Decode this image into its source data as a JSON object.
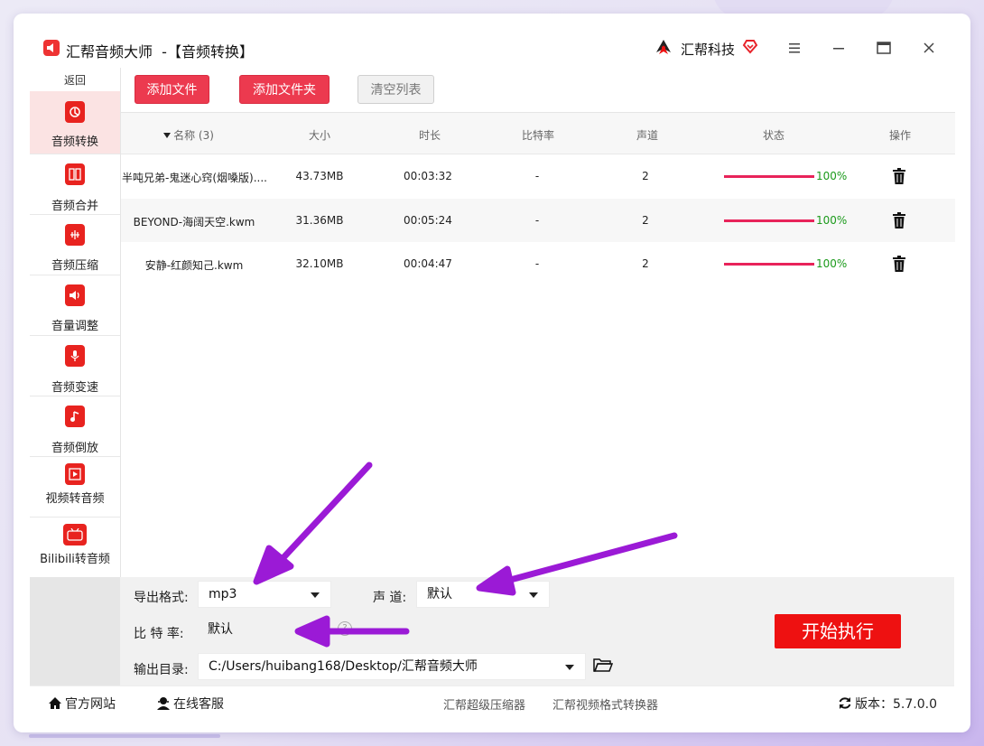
{
  "window": {
    "title": "汇帮音频大师  -【音频转换】",
    "brand": "汇帮科技"
  },
  "sidebar": {
    "back": "返回",
    "items": [
      {
        "label": "音频转换",
        "icon": "audio-convert-icon",
        "active": true
      },
      {
        "label": "音频合并",
        "icon": "audio-merge-icon"
      },
      {
        "label": "音频压缩",
        "icon": "audio-compress-icon"
      },
      {
        "label": "音量调整",
        "icon": "volume-icon"
      },
      {
        "label": "音频变速",
        "icon": "microphone-icon"
      },
      {
        "label": "音频倒放",
        "icon": "music-note-icon"
      },
      {
        "label": "视频转音频",
        "icon": "video-to-audio-icon"
      },
      {
        "label": "Bilibili转音频",
        "icon": "bilibili-icon"
      }
    ]
  },
  "toolbar": {
    "add_file": "添加文件",
    "add_folder": "添加文件夹",
    "clear_list": "清空列表"
  },
  "table": {
    "headers": {
      "name": "名称 (3)",
      "size": "大小",
      "duration": "时长",
      "bitrate": "比特率",
      "channels": "声道",
      "status": "状态",
      "action": "操作"
    },
    "rows": [
      {
        "name": "半吨兄弟-鬼迷心窍(烟嗓版)....",
        "size": "43.73MB",
        "duration": "00:03:32",
        "bitrate": "-",
        "channels": "2",
        "progress": 100,
        "progress_text": "100%"
      },
      {
        "name": "BEYOND-海阔天空.kwm",
        "size": "31.36MB",
        "duration": "00:05:24",
        "bitrate": "-",
        "channels": "2",
        "progress": 100,
        "progress_text": "100%"
      },
      {
        "name": "安静-红颜知己.kwm",
        "size": "32.10MB",
        "duration": "00:04:47",
        "bitrate": "-",
        "channels": "2",
        "progress": 100,
        "progress_text": "100%"
      }
    ]
  },
  "settings": {
    "format_label": "导出格式:",
    "format_value": "mp3",
    "channel_label": "声 道:",
    "channel_value": "默认",
    "bitrate_label": "比 特 率:",
    "bitrate_value": "默认",
    "output_label": "输出目录:",
    "output_value": "C:/Users/huibang168/Desktop/汇帮音频大师",
    "start": "开始执行"
  },
  "footer": {
    "website": "官方网站",
    "support": "在线客服",
    "link1": "汇帮超级压缩器",
    "link2": "汇帮视频格式转换器",
    "version": "版本：5.7.0.0"
  },
  "colors": {
    "accent": "#ec3a4f",
    "start_button": "#ee1111",
    "progress": "#e8235a",
    "success_text": "#1b9a1b",
    "annotation_arrow": "#9b1ad6"
  }
}
